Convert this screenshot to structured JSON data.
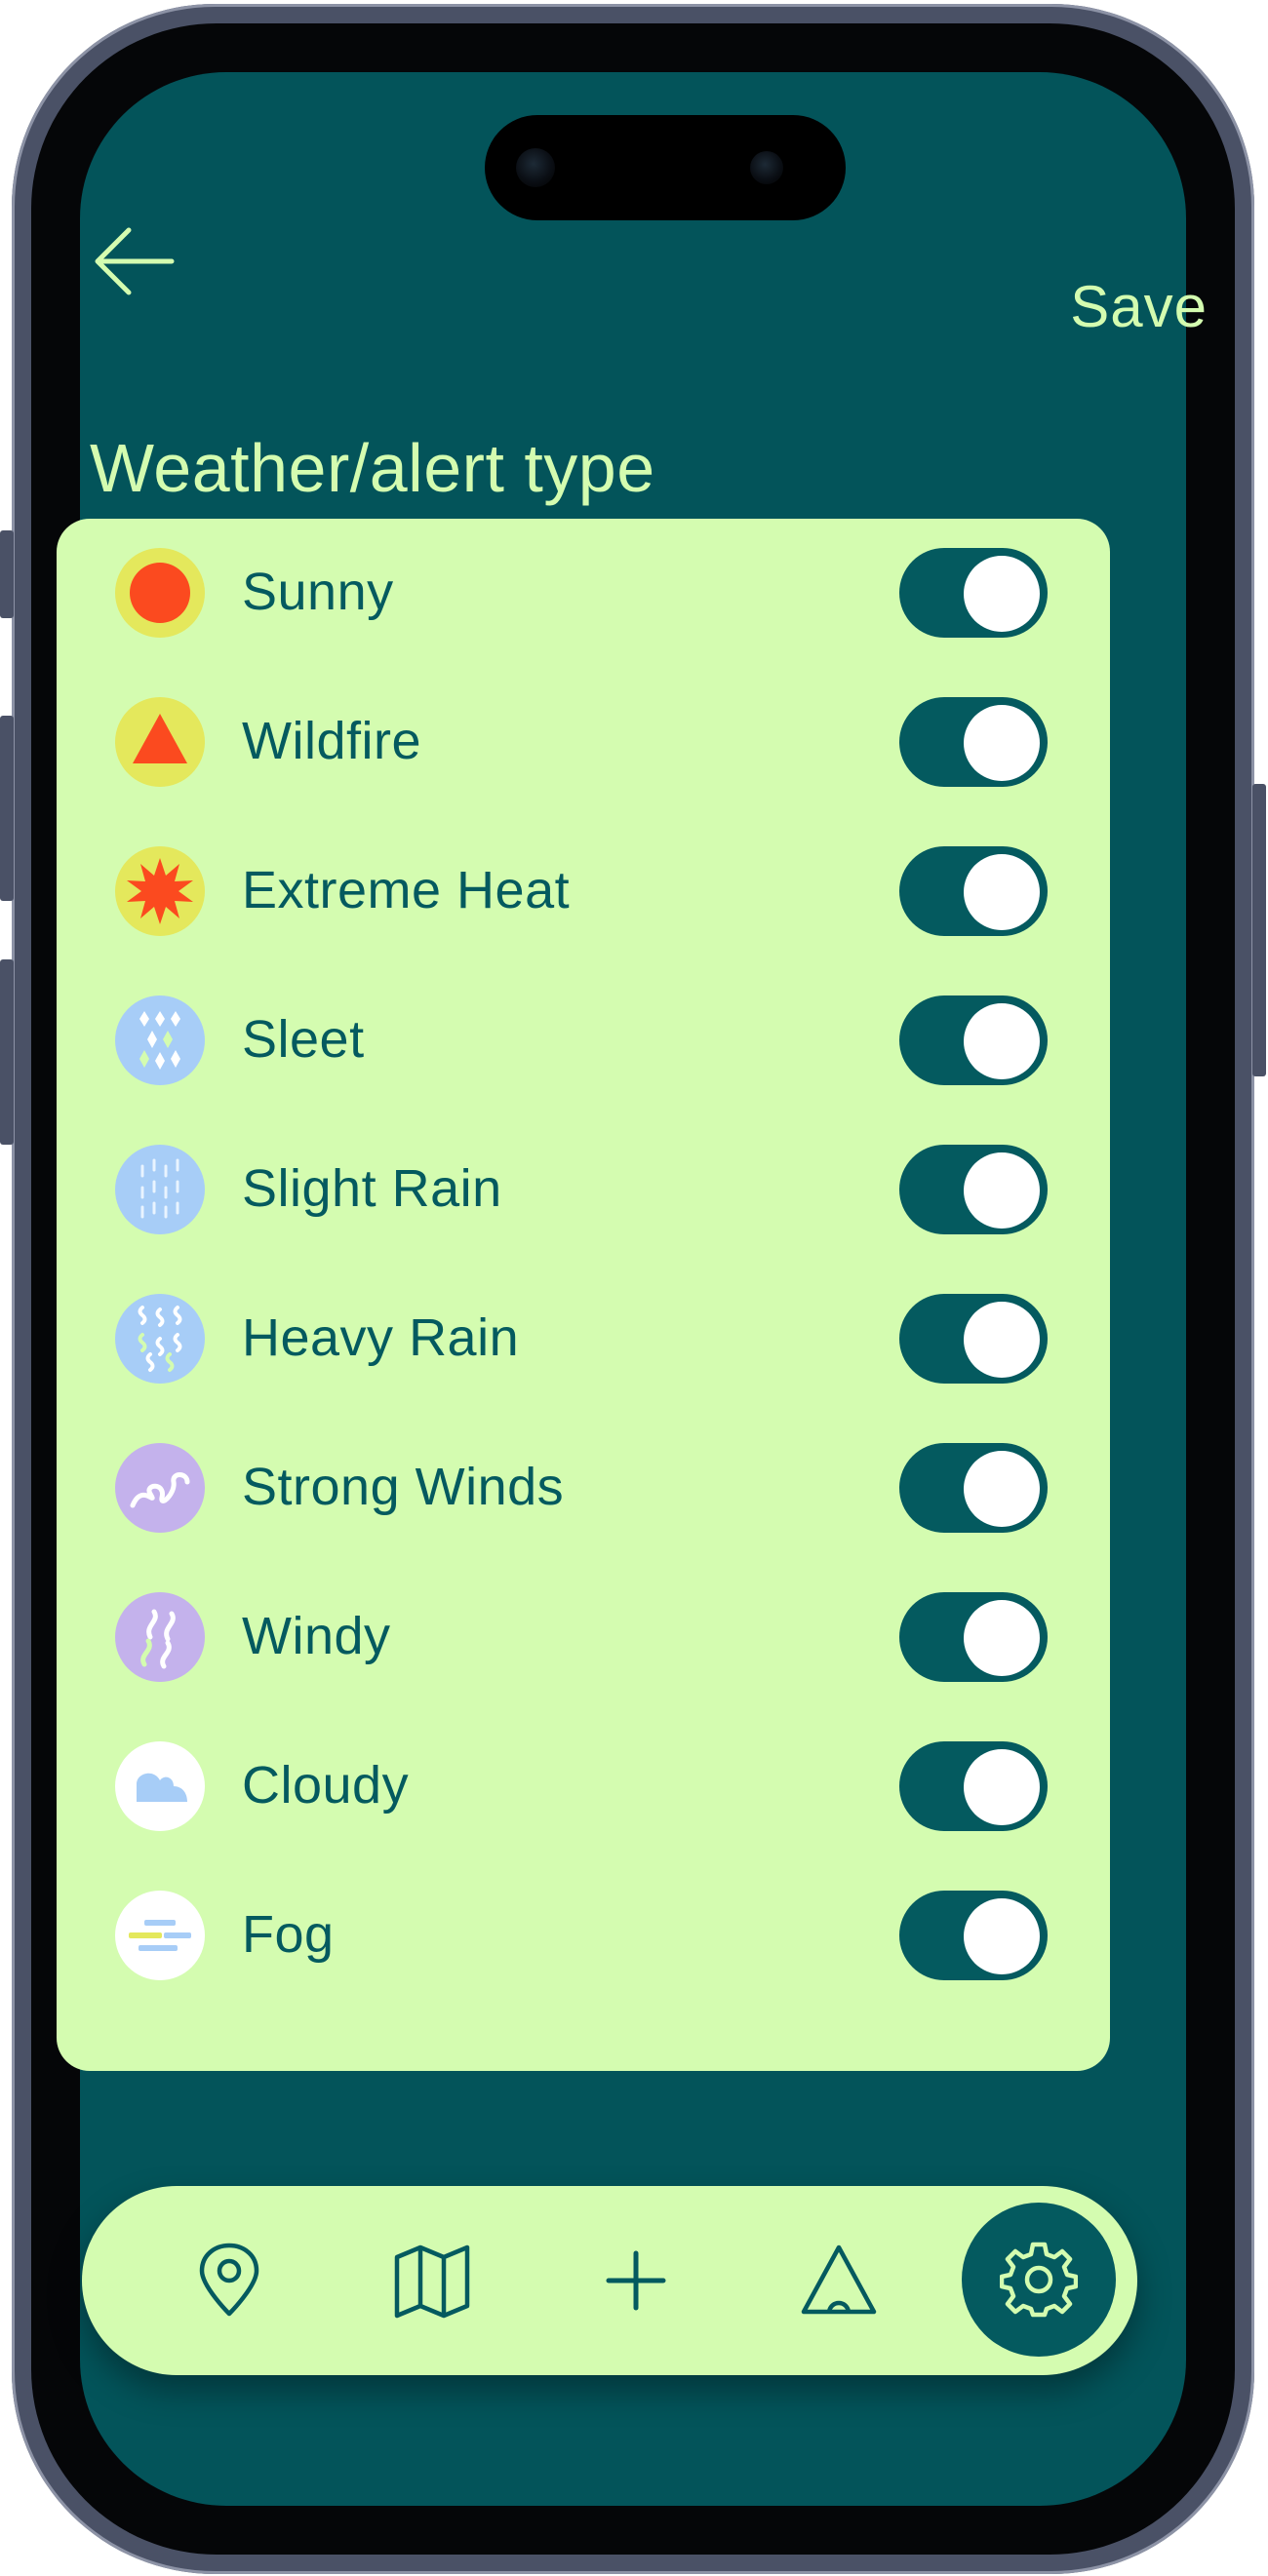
{
  "header": {
    "back_icon": "arrow-left-icon",
    "save_label": "Save",
    "title": "Weather/alert type"
  },
  "alert_types": [
    {
      "label": "Sunny",
      "icon": "sun-icon",
      "enabled": true
    },
    {
      "label": "Wildfire",
      "icon": "wildfire-icon",
      "enabled": true
    },
    {
      "label": "Extreme Heat",
      "icon": "extreme-heat-icon",
      "enabled": true
    },
    {
      "label": "Sleet",
      "icon": "sleet-icon",
      "enabled": true
    },
    {
      "label": "Slight Rain",
      "icon": "slight-rain-icon",
      "enabled": true
    },
    {
      "label": "Heavy Rain",
      "icon": "heavy-rain-icon",
      "enabled": true
    },
    {
      "label": "Strong Winds",
      "icon": "strong-winds-icon",
      "enabled": true
    },
    {
      "label": "Windy",
      "icon": "windy-icon",
      "enabled": true
    },
    {
      "label": "Cloudy",
      "icon": "cloud-icon",
      "enabled": true
    },
    {
      "label": "Fog",
      "icon": "fog-icon",
      "enabled": true
    }
  ],
  "bottom_nav": {
    "items": [
      "location-pin-icon",
      "map-icon",
      "plus-icon",
      "tent-icon",
      "gear-icon"
    ],
    "active": "gear-icon"
  },
  "colors": {
    "background": "#03545a",
    "card": "#d4fcb0",
    "accent_text": "#d4fcb0",
    "label_text": "#045a5f",
    "toggle_on": "#045a5f",
    "sun_red": "#fb4a1f",
    "warm_circle": "#e4e85c",
    "rain_circle": "#a7cdf7",
    "wind_circle": "#c4b2ec"
  }
}
